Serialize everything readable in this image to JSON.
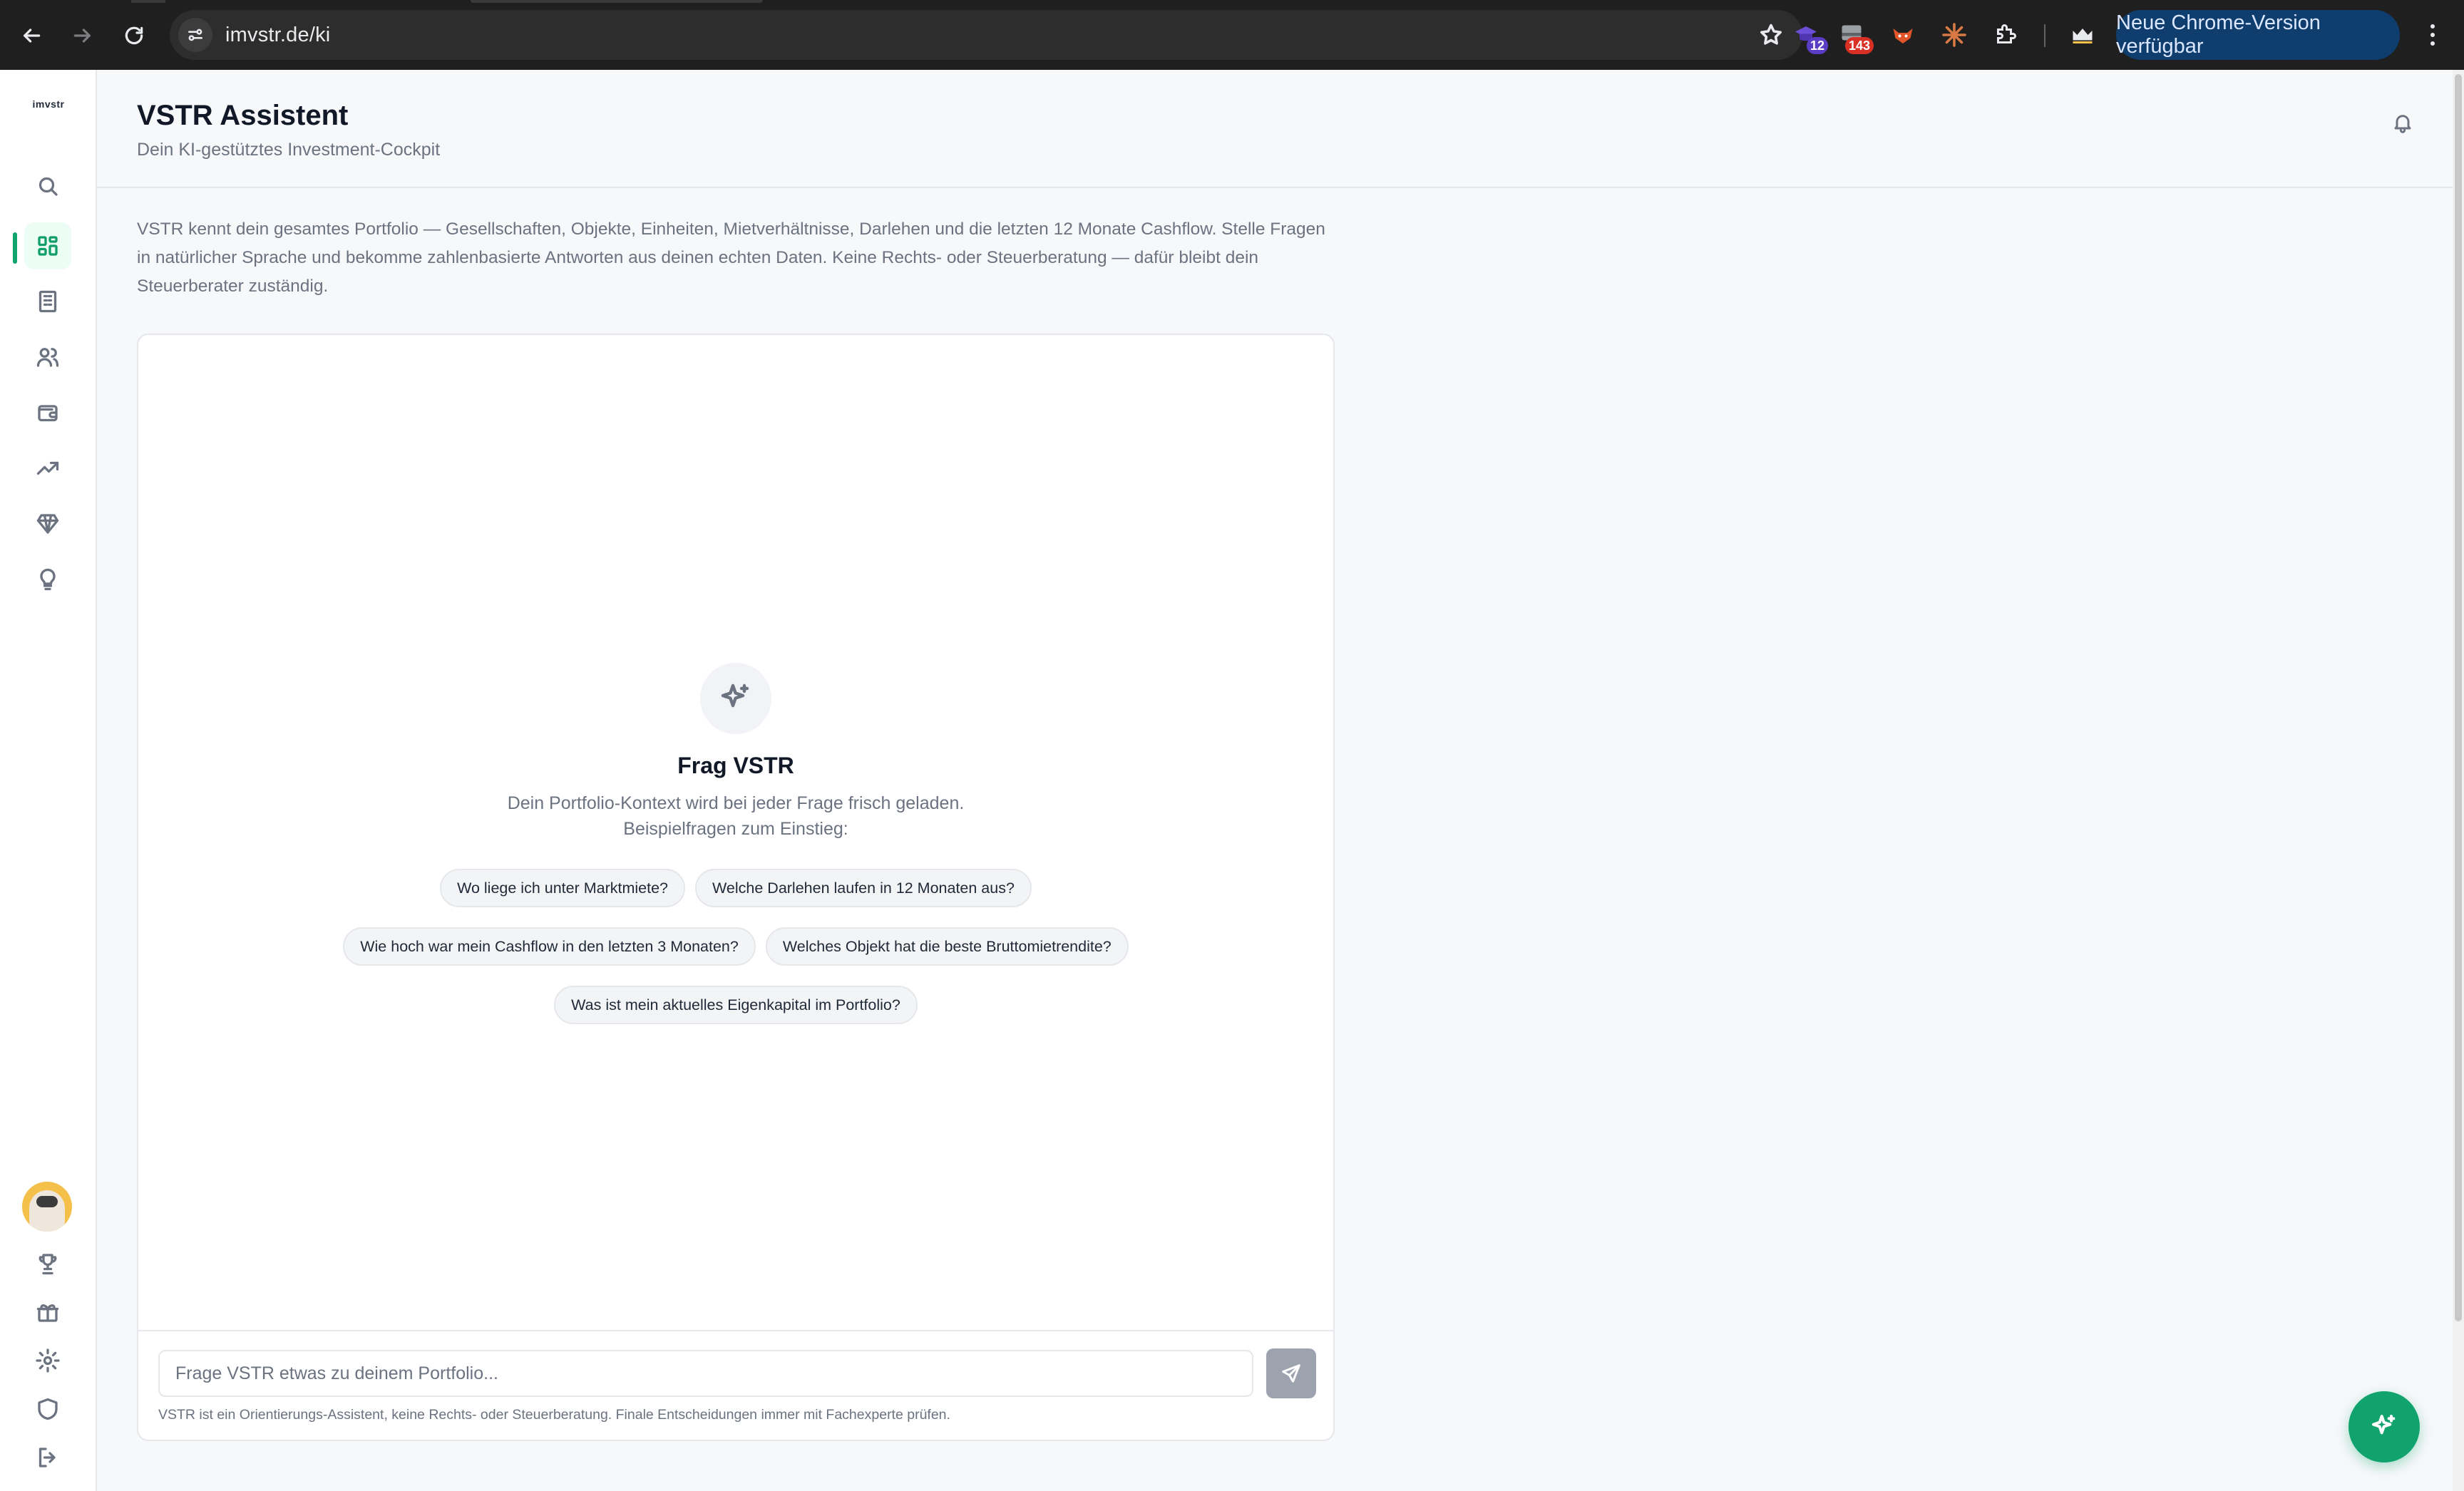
{
  "browser": {
    "url": "imvstr.de/ki",
    "extensions": [
      {
        "name": "extension-purple",
        "badge": "12",
        "badge_color": "#5b3cc4"
      },
      {
        "name": "extension-red",
        "badge": "143",
        "badge_color": "#d93025"
      }
    ],
    "update_label": "Neue Chrome-Version verfügbar"
  },
  "sidebar": {
    "logo": "imvstr"
  },
  "header": {
    "title": "VSTR Assistent",
    "subtitle": "Dein KI-gestütztes Investment-Cockpit"
  },
  "intro": "VSTR kennt dein gesamtes Portfolio — Gesellschaften, Objekte, Einheiten, Mietverhältnisse, Darlehen und die letzten 12 Monate Cashflow. Stelle Fragen in natürlicher Sprache und bekomme zahlenbasierte Antworten aus deinen echten Daten. Keine Rechts- oder Steuerberatung — dafür bleibt dein Steuerberater zuständig.",
  "chat": {
    "empty_title": "Frag VSTR",
    "empty_desc": "Dein Portfolio-Kontext wird bei jeder Frage frisch geladen. Beispielfragen zum Einstieg:",
    "suggestions": [
      "Wo liege ich unter Marktmiete?",
      "Welche Darlehen laufen in 12 Monaten aus?",
      "Wie hoch war mein Cashflow in den letzten 3 Monaten?",
      "Welches Objekt hat die beste Bruttomietrendite?",
      "Was ist mein aktuelles Eigenkapital im Portfolio?"
    ],
    "input_value": "",
    "input_placeholder": "Frage VSTR etwas zu deinem Portfolio...",
    "disclaimer": "VSTR ist ein Orientierungs-Assistent, keine Rechts- oder Steuerberatung. Finale Entscheidungen immer mit Fachexperte prüfen."
  },
  "colors": {
    "accent": "#10a36e",
    "chrome_bg": "#1f1f1f"
  }
}
